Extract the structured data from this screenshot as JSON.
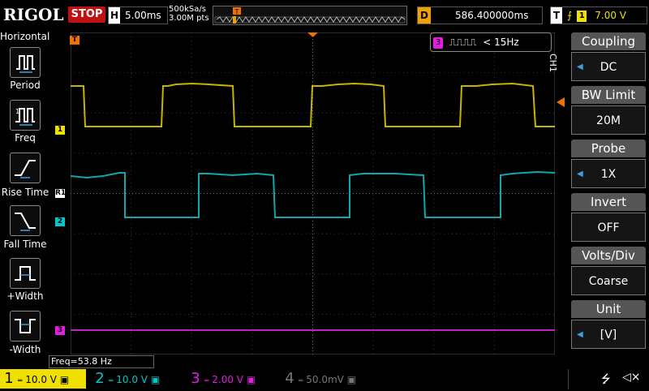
{
  "brand": {
    "logo": "RIGOL"
  },
  "run_state": {
    "label": "STOP"
  },
  "timebase": {
    "tag": "H",
    "value": "5.00ms"
  },
  "acquisition": {
    "sample_rate": "500kSa/s",
    "memory_depth": "3.00M pts"
  },
  "delay": {
    "tag": "D",
    "value": "586.400000ms"
  },
  "trigger": {
    "tag": "T",
    "source": "1",
    "level": "7.00 V"
  },
  "left_menu": {
    "title": "Horizontal",
    "items": [
      {
        "label": "Period",
        "icon": "period-icon"
      },
      {
        "label": "Freq",
        "icon": "freq-icon"
      },
      {
        "label": "Rise Time",
        "icon": "rise-time-icon"
      },
      {
        "label": "Fall Time",
        "icon": "fall-time-icon"
      },
      {
        "label": "+Width",
        "icon": "positive-width-icon"
      },
      {
        "label": "-Width",
        "icon": "negative-width-icon"
      }
    ]
  },
  "counter": {
    "channel": "3",
    "text": "< 15Hz"
  },
  "freq_readout": "Freq=53.8 Hz",
  "right_menu": {
    "channel_tag": "CH1",
    "items": [
      {
        "title": "Coupling",
        "value": "DC",
        "arrow": true
      },
      {
        "title": "BW Limit",
        "value": "20M",
        "arrow": false
      },
      {
        "title": "Probe",
        "value": "1X",
        "arrow": true
      },
      {
        "title": "Invert",
        "value": "OFF",
        "arrow": false
      },
      {
        "title": "Volts/Div",
        "value": "Coarse",
        "arrow": false
      },
      {
        "title": "Unit",
        "value": "[V]",
        "arrow": true
      }
    ]
  },
  "channels": [
    {
      "num": "1",
      "scale": "10.0 V",
      "color": "#f0e000"
    },
    {
      "num": "2",
      "scale": "10.0 V",
      "color": "#00c8c8"
    },
    {
      "num": "3",
      "scale": "2.00 V",
      "color": "#e020e0"
    },
    {
      "num": "4",
      "scale": "50.0mV",
      "color": "#777777"
    }
  ],
  "trace_markers": {
    "ch1": "1",
    "ch2": "2",
    "ch3": "3",
    "r1": "R1",
    "trigger": "T"
  },
  "colors": {
    "ch1": "#c8b400",
    "ch2": "#10a8a8",
    "ch3": "#c020c0",
    "grid": "#444444",
    "menu_head": "#555555"
  }
}
